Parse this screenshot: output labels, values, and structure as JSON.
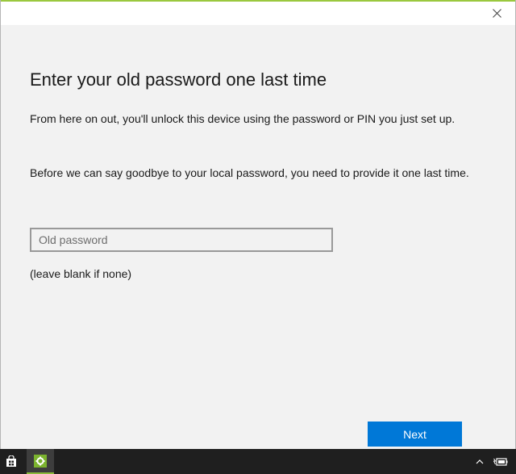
{
  "dialog": {
    "heading": "Enter your old password one last time",
    "paragraph1": "From here on out, you'll unlock this device using the password or PIN you just set up.",
    "paragraph2": "Before we can say goodbye to your local password, you need to provide it one last time.",
    "password_placeholder": "Old password",
    "password_value": "",
    "hint": "(leave blank if none)",
    "next_label": "Next"
  },
  "colors": {
    "accent_button": "#0078d7",
    "title_accent": "#9ac83e",
    "background": "#f2f2f2",
    "taskbar": "#1f1f1f"
  },
  "icons": {
    "close": "close-icon",
    "store": "store-icon",
    "settings": "gear-icon",
    "tray_expand": "chevron-up-icon",
    "battery": "battery-icon"
  }
}
